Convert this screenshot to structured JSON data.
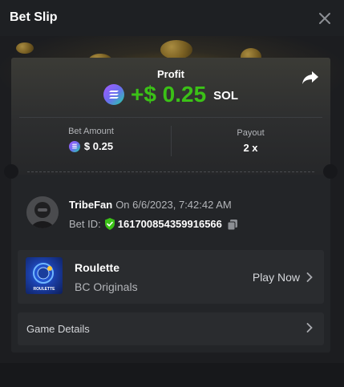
{
  "header": {
    "title": "Bet Slip",
    "close_icon": "close-icon"
  },
  "profit": {
    "label": "Profit",
    "value": "+$ 0.25",
    "currency": "SOL",
    "currency_icon": "solana-icon",
    "value_color": "#3bc117"
  },
  "stats": {
    "bet_amount_label": "Bet Amount",
    "bet_amount_value": "$ 0.25",
    "payout_label": "Payout",
    "payout_value": "2 x"
  },
  "user": {
    "name": "TribeFan",
    "date": "On 6/6/2023, 7:42:42 AM",
    "bet_id_label": "Bet ID:",
    "bet_id": "161700854359916566"
  },
  "game": {
    "name": "Roulette",
    "provider": "BC Originals",
    "thumb_label": "ROULETTE",
    "play_label": "Play Now"
  },
  "details": {
    "label": "Game Details"
  },
  "colors": {
    "background": "#17181b",
    "card": "#232528",
    "row": "#2a2c2f",
    "accent_green": "#3bc117",
    "muted_text": "#b3b5b9"
  }
}
